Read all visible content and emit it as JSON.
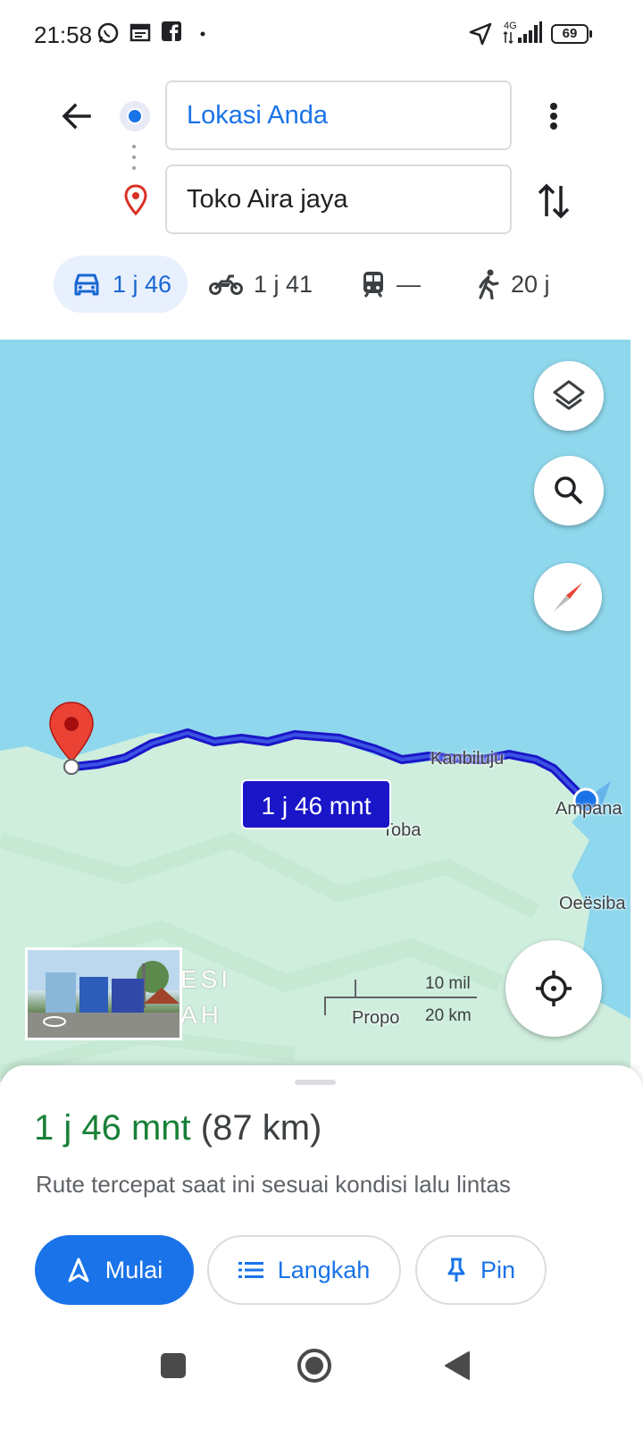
{
  "status_bar": {
    "time": "21:58",
    "icons": [
      "whatsapp-icon",
      "calendar-icon",
      "facebook-icon",
      "dot-icon",
      "location-arrow-icon",
      "signal-4g-icon"
    ],
    "network": "4G",
    "battery": "69"
  },
  "header": {
    "origin": "Lokasi Anda",
    "destination": "Toko Aira jaya",
    "modes": [
      {
        "icon": "car-icon",
        "label": "1 j 46",
        "active": true
      },
      {
        "icon": "motorcycle-icon",
        "label": "1 j 41",
        "active": false
      },
      {
        "icon": "transit-icon",
        "label": "—",
        "active": false
      },
      {
        "icon": "walk-icon",
        "label": "20 j",
        "active": false
      }
    ]
  },
  "map": {
    "route_label": "1 j 46 mnt",
    "places": [
      "Kanbiluju",
      "Ampana",
      "Toba",
      "Oeësiba",
      "Propo"
    ],
    "region_lines": [
      "ESI",
      "AH"
    ],
    "scale_top": "10 mil",
    "scale_bottom": "20 km",
    "colors": {
      "water": "#8fd7ec",
      "land": "#cfeedd",
      "route": "#1a16c8"
    }
  },
  "sheet": {
    "duration": "1 j 46 mnt",
    "distance": "(87 km)",
    "subtitle": "Rute tercepat saat ini sesuai kondisi lalu lintas",
    "start_label": "Mulai",
    "steps_label": "Langkah",
    "pin_label": "Pin"
  }
}
